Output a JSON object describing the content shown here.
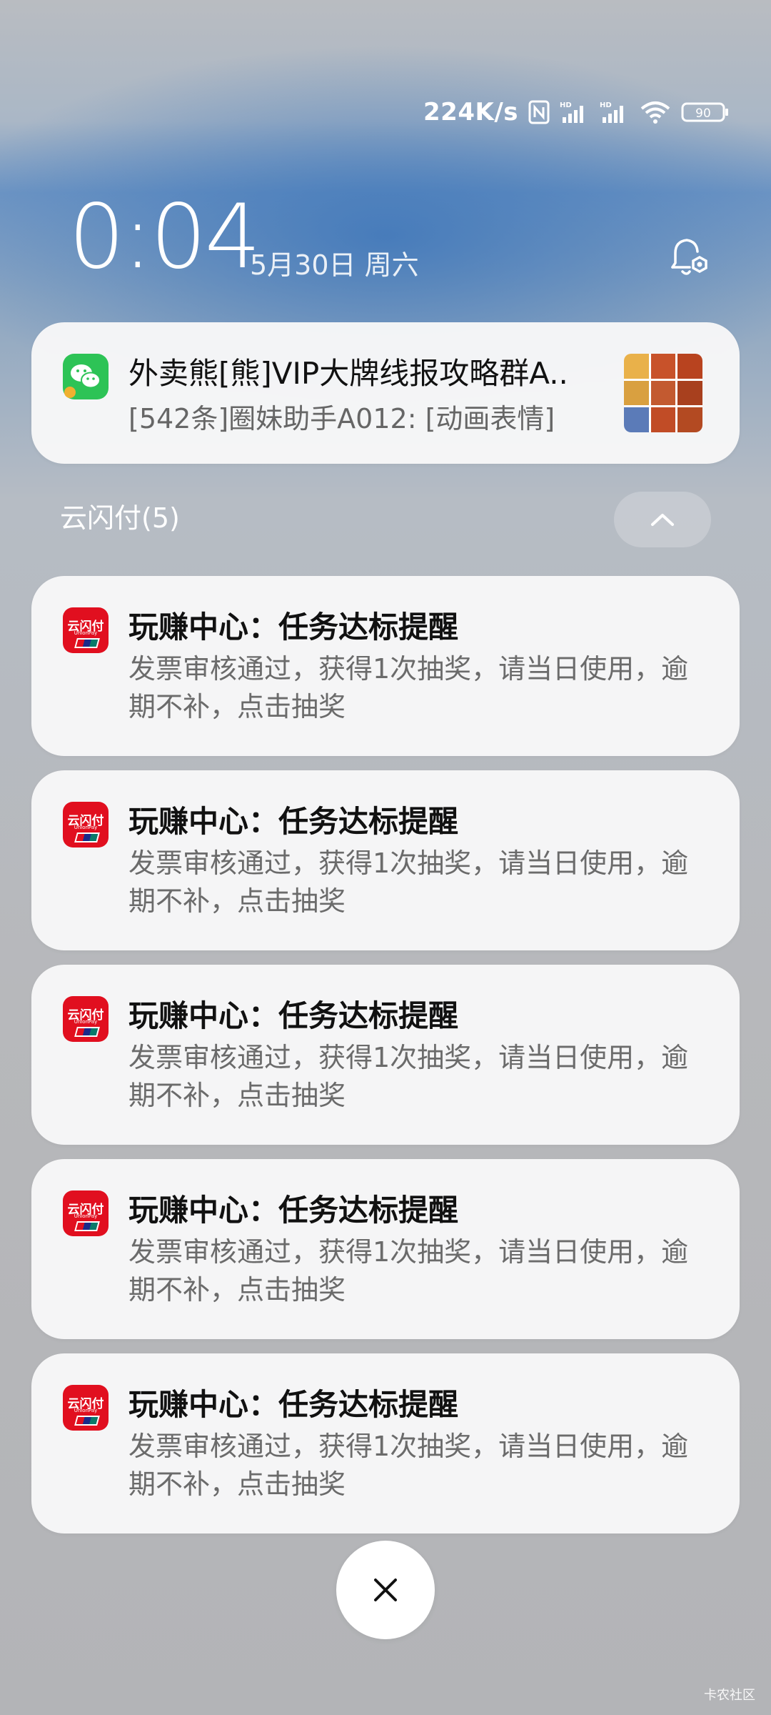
{
  "status_bar": {
    "net_speed": "224K/s",
    "battery": "90",
    "icons": [
      "nfc-icon",
      "hd-signal-icon",
      "hd-signal-icon",
      "wifi-icon",
      "battery-icon"
    ]
  },
  "lockscreen": {
    "time": "0:04",
    "date": "5月30日 周六"
  },
  "wechat_notification": {
    "icon": "wechat-icon",
    "title": "外卖熊[熊]VIP大牌线报攻略群A..",
    "body": "[542条]圈妹助手A012: [动画表情]"
  },
  "group": {
    "label": "云闪付(5)"
  },
  "notifications": [
    {
      "title": "玩赚中心：任务达标提醒",
      "body": "发票审核通过，获得1次抽奖，请当日使用，逾期不补，点击抽奖"
    },
    {
      "title": "玩赚中心：任务达标提醒",
      "body": "发票审核通过，获得1次抽奖，请当日使用，逾期不补，点击抽奖"
    },
    {
      "title": "玩赚中心：任务达标提醒",
      "body": "发票审核通过，获得1次抽奖，请当日使用，逾期不补，点击抽奖"
    },
    {
      "title": "玩赚中心：任务达标提醒",
      "body": "发票审核通过，获得1次抽奖，请当日使用，逾期不补，点击抽奖"
    },
    {
      "title": "玩赚中心：任务达标提醒",
      "body": "发票审核通过，获得1次抽奖，请当日使用，逾期不补，点击抽奖"
    }
  ],
  "unionpay_logo": {
    "text": "云闪付",
    "sub": "UnionPay"
  },
  "watermark": "卡农社区",
  "colors": {
    "wechat_green": "#2dc356",
    "unionpay_red": "#e10f1f"
  }
}
